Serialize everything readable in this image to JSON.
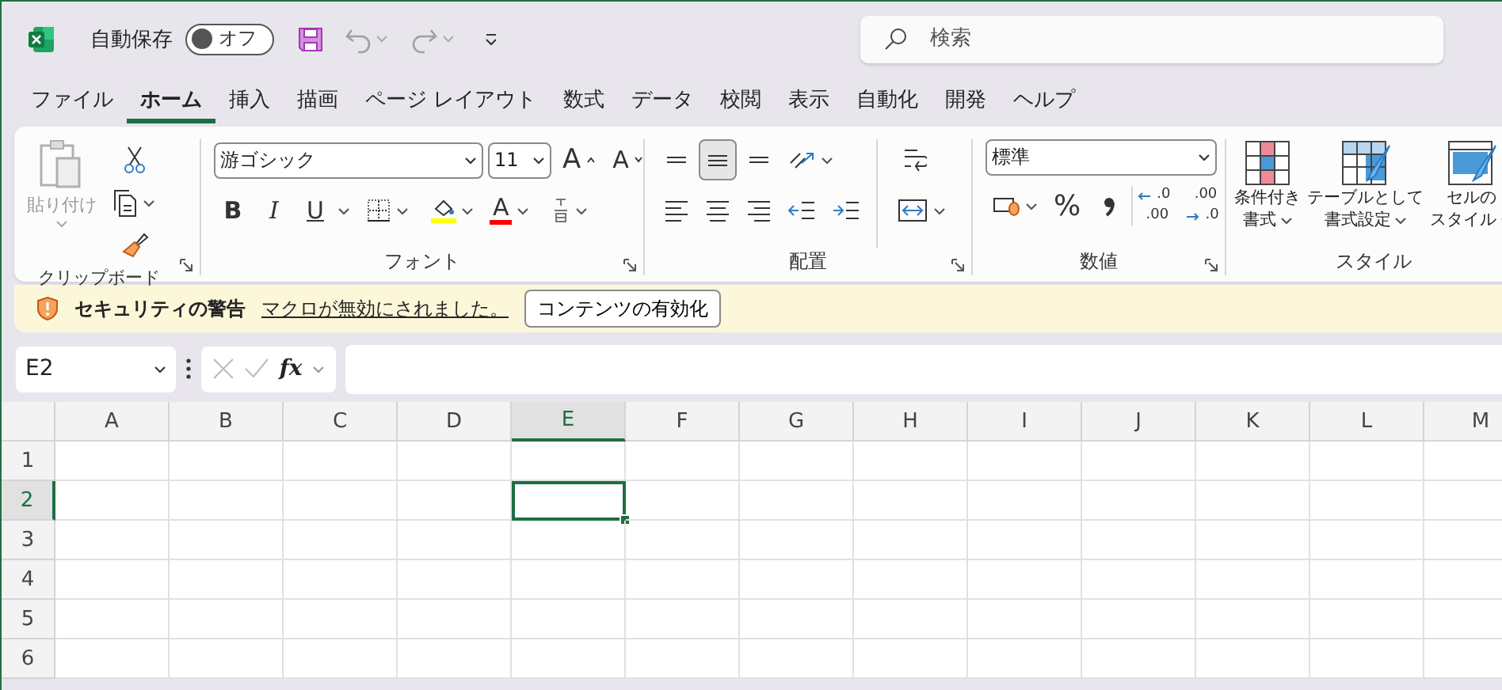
{
  "title_bar": {
    "autosave": {
      "label": "自動保存",
      "on": false,
      "state_label": "オフ"
    },
    "search": {
      "placeholder": "検索"
    }
  },
  "tabs": [
    {
      "label": "ファイル",
      "selected": false
    },
    {
      "label": "ホーム",
      "selected": true
    },
    {
      "label": "挿入",
      "selected": false
    },
    {
      "label": "描画",
      "selected": false
    },
    {
      "label": "ページ レイアウト",
      "selected": false
    },
    {
      "label": "数式",
      "selected": false
    },
    {
      "label": "データ",
      "selected": false
    },
    {
      "label": "校閲",
      "selected": false
    },
    {
      "label": "表示",
      "selected": false
    },
    {
      "label": "自動化",
      "selected": false
    },
    {
      "label": "開発",
      "selected": false
    },
    {
      "label": "ヘルプ",
      "selected": false
    }
  ],
  "ribbon": {
    "clipboard": {
      "label": "クリップボード",
      "paste": {
        "label": "貼り付け",
        "disabled": true
      }
    },
    "font": {
      "label": "フォント",
      "font_name": "游ゴシック",
      "font_size": "11",
      "grow_glyph": "A",
      "shrink_glyph": "A",
      "styles": [
        {
          "kind": "bold",
          "glyph": "B"
        },
        {
          "kind": "italic",
          "glyph": "I"
        },
        {
          "kind": "underline",
          "glyph": "U"
        }
      ],
      "font_color_glyph": "A"
    },
    "alignment": {
      "label": "配置",
      "vertical": [
        {
          "kind": "top",
          "selected": false
        },
        {
          "kind": "middle",
          "selected": true
        },
        {
          "kind": "bottom",
          "selected": false
        }
      ]
    },
    "number": {
      "label": "数値",
      "format": "標準",
      "percent_glyph": "%",
      "decimal_increase": {
        "top": ".0",
        "bottom": ".00"
      },
      "decimal_decrease": {
        "top": ".00",
        "bottom": ".0"
      }
    },
    "styles": {
      "label": "スタイル",
      "buttons": [
        {
          "kind": "conditional",
          "lines": [
            "条件付き",
            "書式"
          ]
        },
        {
          "kind": "table",
          "lines": [
            "テーブルとして",
            "書式設定"
          ]
        },
        {
          "kind": "cell",
          "lines": [
            "セルの",
            "スタイル"
          ]
        }
      ]
    }
  },
  "security_bar": {
    "title": "セキュリティの警告",
    "message": "マクロが無効にされました。",
    "button": "コンテンツの有効化"
  },
  "formula_bar": {
    "name_box": "E2",
    "fx_glyph": "fx"
  },
  "sheet": {
    "columns": [
      {
        "label": "A",
        "selected": false
      },
      {
        "label": "B",
        "selected": false
      },
      {
        "label": "C",
        "selected": false
      },
      {
        "label": "D",
        "selected": false
      },
      {
        "label": "E",
        "selected": true
      },
      {
        "label": "F",
        "selected": false
      },
      {
        "label": "G",
        "selected": false
      },
      {
        "label": "H",
        "selected": false
      },
      {
        "label": "I",
        "selected": false
      },
      {
        "label": "J",
        "selected": false
      },
      {
        "label": "K",
        "selected": false
      },
      {
        "label": "L",
        "selected": false
      },
      {
        "label": "M",
        "selected": false
      }
    ],
    "rows": [
      {
        "label": "1",
        "selected": false
      },
      {
        "label": "2",
        "selected": true
      },
      {
        "label": "3",
        "selected": false
      },
      {
        "label": "4",
        "selected": false
      },
      {
        "label": "5",
        "selected": false
      },
      {
        "label": "6",
        "selected": false
      }
    ]
  }
}
